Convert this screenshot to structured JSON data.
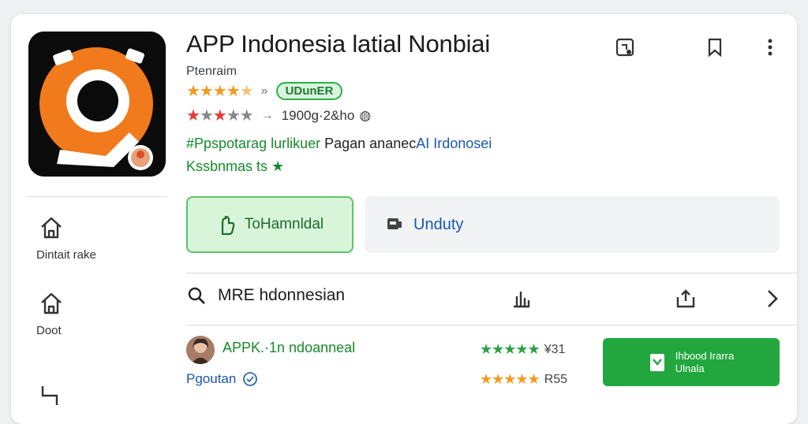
{
  "app": {
    "title": "APP Indonesia latial Nonbiai",
    "publisher": "Ptenraim",
    "badge": "UDunER",
    "downloads": "1900g·2&ho",
    "tagline_green": "#Ppspotarag lurlikuer",
    "tagline_dark": "Pagan ananec",
    "tagline_blue": "AI Irdonosei",
    "category": "Kssbnmas ts ★"
  },
  "colors": {
    "accent_green": "#22a73f",
    "link_blue": "#1a56b0",
    "star_orange": "#f39a1e",
    "icon_orange": "#f07a1c"
  },
  "nav": {
    "items": [
      {
        "label": "Dintait rake",
        "icon": "home-icon"
      },
      {
        "label": "Doot",
        "icon": "home-icon"
      }
    ]
  },
  "actions": {
    "install_label": "ToHamnldal",
    "secondary_label": "Unduty"
  },
  "search": {
    "text": "MRE hdonnesian"
  },
  "review": {
    "title": "APPK.·1n ndoanneal",
    "author": "Pgoutan",
    "count1": "¥31",
    "count2": "R55",
    "cta_line1": "Ihbood Irarra",
    "cta_line2": "Ulnala"
  }
}
